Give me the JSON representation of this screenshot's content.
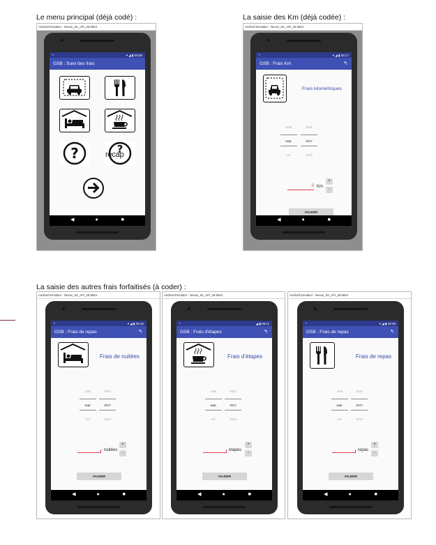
{
  "captions": {
    "menu": "Le menu principal (déjà codé) :",
    "km": "La saisie des Km (déjà codée) :",
    "autres": "La saisie des autres frais forfaitisés (à coder) :"
  },
  "emulator_title": "Android Emulator - Nexus_5X_API_26:5554",
  "nav": {
    "back": "◀",
    "home": "●",
    "recents": "■"
  },
  "phones": {
    "menu": {
      "time": "08:50",
      "title": "GSB : Suivi des frais",
      "icons": [
        "car-icon",
        "fork-knife-icon",
        "bed-icon",
        "coffee-icon",
        "help-icon",
        "recap-icon"
      ],
      "recap_label": "recap",
      "next_icon": "→"
    },
    "km": {
      "time": "08:17",
      "title": "GSB : Frais Km",
      "heading": "Frais kilométriques",
      "date": {
        "prev_month": "août",
        "month": "sept.",
        "next_month": "oct.",
        "prev_year": "2016",
        "year": "2017",
        "next_year": "2018"
      },
      "input_value": "0",
      "unit": "Km",
      "plus": "+",
      "minus": "-",
      "validate": "VALIDER"
    },
    "nuitees": {
      "time": "09:10",
      "title": "GSB : Frais de repas",
      "heading": "Frais de nuitées",
      "date": {
        "prev_month": "août",
        "month": "sept.",
        "next_month": "oct.",
        "prev_year": "2016",
        "year": "2017",
        "next_year": "2018"
      },
      "unit": "nuitées",
      "plus": "+",
      "minus": "-",
      "validate": "VALIDER"
    },
    "etapes": {
      "time": "09:11",
      "title": "GSB : Frais d'étapes",
      "heading": "Frais d'étapes",
      "date": {
        "prev_month": "août",
        "month": "sept.",
        "next_month": "oct.",
        "prev_year": "2016",
        "year": "2017",
        "next_year": "2018"
      },
      "unit": "étapes",
      "plus": "+",
      "minus": "-",
      "validate": "VALIDER"
    },
    "repas": {
      "time": "09:09",
      "title": "GSB : Frais de repas",
      "heading": "Frais de repas",
      "date": {
        "prev_month": "août",
        "month": "sept.",
        "next_month": "oct.",
        "prev_year": "2016",
        "year": "2017",
        "next_year": "2018"
      },
      "unit": "repas",
      "plus": "+",
      "minus": "-",
      "validate": "VALIDER"
    }
  },
  "colors": {
    "actionbar": "#3f51b5",
    "statusbar": "#2d3a8c",
    "accent_text": "#3a4ab0",
    "input_underline": "#e53953"
  }
}
